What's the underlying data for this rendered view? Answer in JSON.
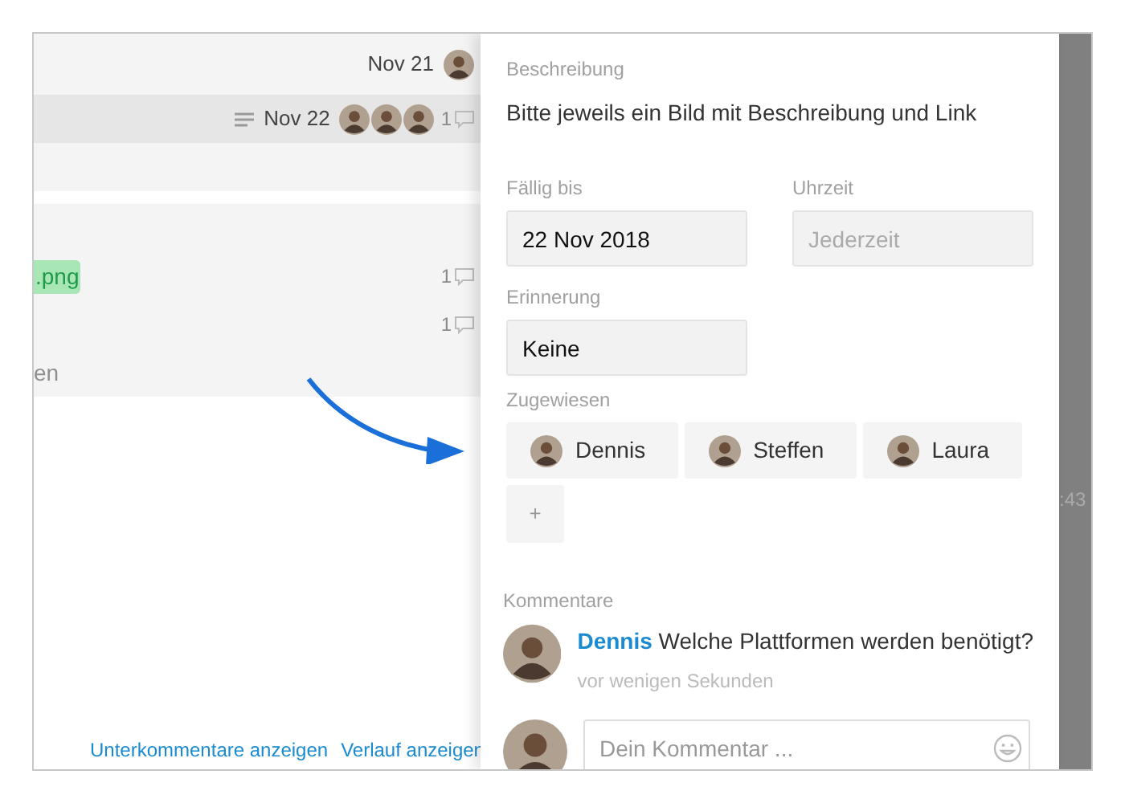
{
  "list": {
    "rows": [
      {
        "selected": false,
        "date": "Nov 21",
        "avatars": [
          {
            "kind": "photo"
          }
        ]
      },
      {
        "selected": true,
        "notes": true,
        "date": "Nov 22",
        "avatars": [
          {
            "kind": "photo"
          },
          {
            "kind": "photo"
          },
          {
            "kind": "photo"
          }
        ],
        "comments": "1"
      },
      {
        "selected": false
      }
    ],
    "group": [
      {
        "kind": "blank"
      },
      {
        "kind": "tag",
        "tag": ".png",
        "comments": "1"
      },
      {
        "kind": "plain",
        "comments": "1"
      },
      {
        "kind": "faded",
        "text": "en"
      }
    ],
    "links": [
      "Unterkommentare anzeigen",
      "Verlauf anzeigen"
    ],
    "clipped_time": ":43"
  },
  "panel": {
    "description_label": "Beschreibung",
    "description": "Bitte jeweils ein Bild mit Beschreibung und Link",
    "due_label": "Fällig bis",
    "due_value": "22 Nov 2018",
    "time_label": "Uhrzeit",
    "time_placeholder": "Jederzeit",
    "reminder_label": "Erinnerung",
    "reminder_value": "Keine",
    "assigned_label": "Zugewiesen",
    "assignees": [
      {
        "name": "Dennis"
      },
      {
        "name": "Steffen"
      },
      {
        "name": "Laura"
      }
    ],
    "add_label": "+",
    "comments_label": "Kommentare",
    "comments": [
      {
        "author": "Dennis",
        "text": "Welche Plattformen werden benötigt?",
        "time": "vor wenigen Sekunden"
      }
    ],
    "comment_placeholder": "Dein Kommentar ..."
  }
}
